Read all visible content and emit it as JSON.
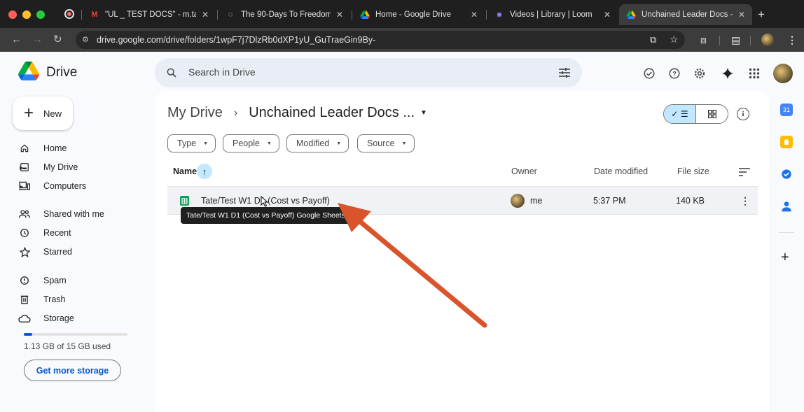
{
  "browser": {
    "tabs": [
      {
        "title": "\"UL _ TEST DOCS\" - m.tate",
        "favicon": "gmail-icon"
      },
      {
        "title": "The 90-Days To Freedom",
        "favicon": "loading-icon"
      },
      {
        "title": "Home - Google Drive",
        "favicon": "drive-icon"
      },
      {
        "title": "Videos | Library | Loom",
        "favicon": "loom-icon"
      },
      {
        "title": "Unchained Leader Docs - Y",
        "favicon": "drive-icon",
        "active": true
      }
    ],
    "url": "drive.google.com/drive/folders/1wpF7j7DlzRb0dXP1yU_GuTraeGin9By-"
  },
  "app": {
    "name": "Drive",
    "search_placeholder": "Search in Drive",
    "new_label": "New"
  },
  "sidebar": {
    "items": [
      {
        "label": "Home",
        "icon": "home-icon"
      },
      {
        "label": "My Drive",
        "icon": "my-drive-icon"
      },
      {
        "label": "Computers",
        "icon": "computers-icon"
      },
      {
        "label": "Shared with me",
        "icon": "shared-icon"
      },
      {
        "label": "Recent",
        "icon": "clock-icon"
      },
      {
        "label": "Starred",
        "icon": "star-icon"
      },
      {
        "label": "Spam",
        "icon": "spam-icon"
      },
      {
        "label": "Trash",
        "icon": "trash-icon"
      },
      {
        "label": "Storage",
        "icon": "cloud-icon"
      }
    ],
    "storage_used": 0.0753,
    "storage_text": "1.13 GB of 15 GB used",
    "get_storage_label": "Get more storage"
  },
  "main": {
    "breadcrumb_root": "My Drive",
    "breadcrumb_current": "Unchained Leader Docs ...",
    "filters": [
      "Type",
      "People",
      "Modified",
      "Source"
    ],
    "columns": {
      "name": "Name",
      "owner": "Owner",
      "date": "Date modified",
      "size": "File size"
    },
    "rows": [
      {
        "name": "Tate/Test W1 D1 (Cost vs Payoff)",
        "owner": "me",
        "date": "5:37 PM",
        "size": "140 KB"
      }
    ],
    "tooltip": "Tate/Test W1 D1 (Cost vs Payoff) Google Sheets"
  },
  "colors": {
    "accent": "#0b57d0",
    "selected": "#c2e7ff",
    "annotation_arrow": "#d9532b"
  }
}
